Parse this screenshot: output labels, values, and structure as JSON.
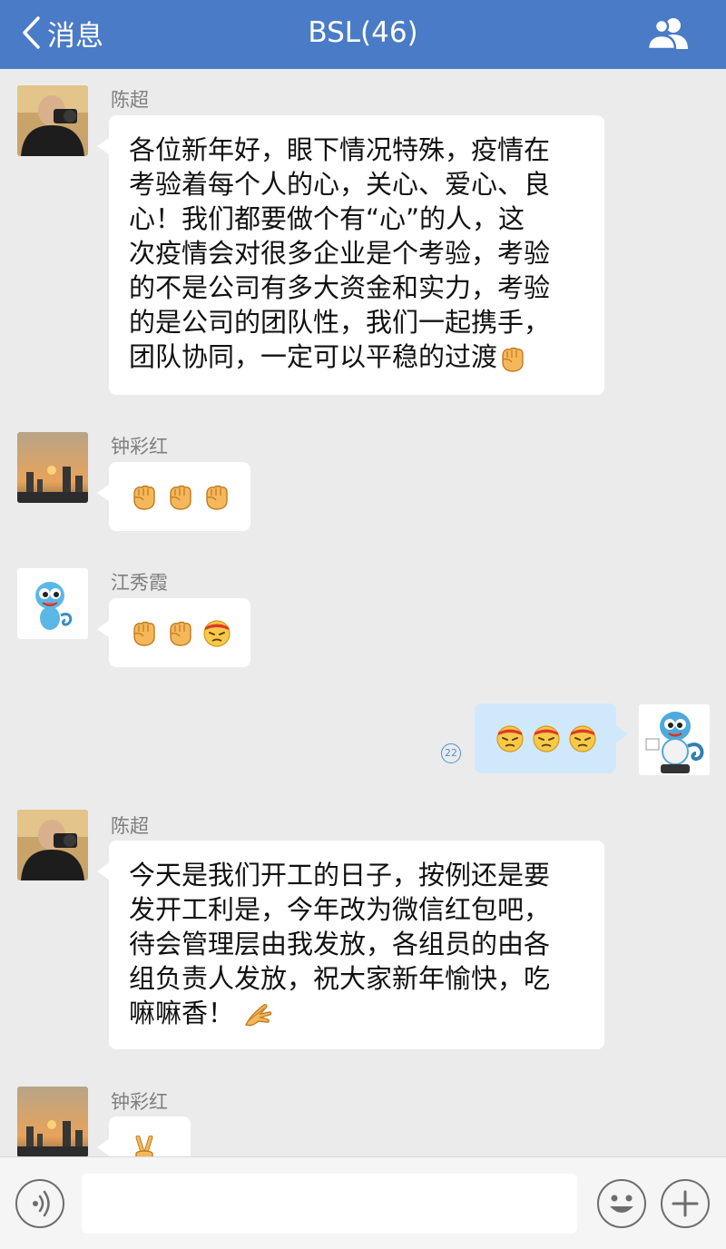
{
  "navbar": {
    "back_label": "消息",
    "title": "BSL(46)",
    "bg_color": "#4a7bc6"
  },
  "messages": [
    {
      "sender": "陈超",
      "avatar": "photographer-avatar",
      "text": "各位新年好，眼下情况特殊，疫情在\n考验着每个人的心，关心、爱心、良\n心！我们都要做个有“心”的人，这\n次疫情会对很多企业是个考验，考验\n的不是公司有多大资金和实力，考验\n的是公司的团队性，我们一起携手，\n团队协同，一定可以平稳的过渡",
      "emojis": [
        "fist-emoji"
      ]
    },
    {
      "sender": "钟彩红",
      "avatar": "sunset-city-avatar",
      "emojis": [
        "fist-emoji",
        "fist-emoji",
        "fist-emoji"
      ]
    },
    {
      "sender": "江秀霞",
      "avatar": "chameleon-avatar",
      "emojis": [
        "fist-emoji",
        "fist-emoji",
        "determined-face-emoji"
      ]
    },
    {
      "sender": "",
      "outgoing": true,
      "read_count": "22",
      "avatar": "chameleon-mascot-avatar",
      "emojis": [
        "determined-face-emoji",
        "determined-face-emoji",
        "determined-face-emoji"
      ]
    },
    {
      "sender": "陈超",
      "avatar": "photographer-avatar",
      "text": "今天是我们开工的日子，按例还是要\n发开工利是，今年改为微信红包吧，\n待会管理层由我发放，各组员的由各\n组负责人发放，祝大家新年愉快，吃\n嘛嘛香！ ",
      "emojis": [
        "clap-hands-emoji"
      ]
    },
    {
      "sender": "钟彩红",
      "avatar": "sunset-city-avatar",
      "emojis": [
        "victory-hand-emoji"
      ]
    }
  ],
  "inputbar": {
    "voice_icon": "voice-icon",
    "emoji_icon": "smiley-icon",
    "add_icon": "plus-icon",
    "input_value": ""
  }
}
